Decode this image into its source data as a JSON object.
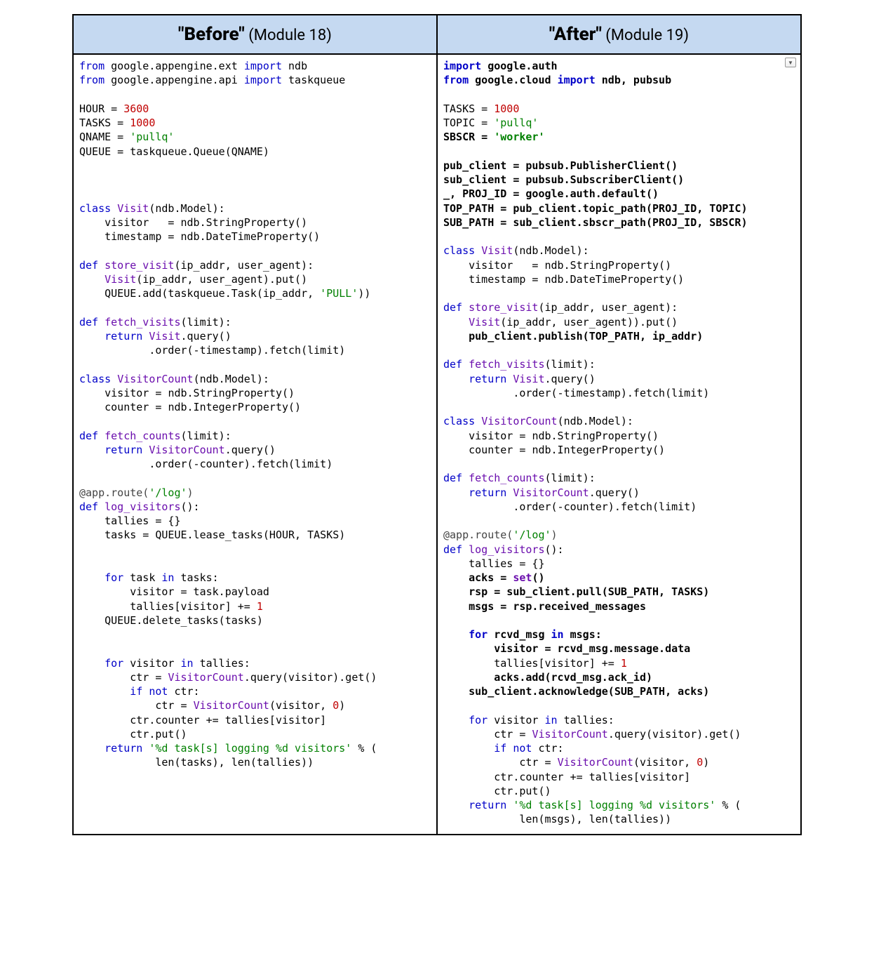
{
  "columns": {
    "before": {
      "title_quoted": "\"Before\"",
      "title_paren": " (Module 18)"
    },
    "after": {
      "title_quoted": "\"After\"",
      "title_paren": " (Module 19)"
    }
  },
  "code": {
    "before": {
      "imports": [
        "from google.appengine.ext import ndb",
        "from google.appengine.api import taskqueue"
      ],
      "constants": {
        "HOUR": 3600,
        "TASKS": 1000,
        "QNAME": "'pullq'",
        "QUEUE_expr": "taskqueue.Queue(QNAME)"
      },
      "class_visit": {
        "name": "Visit",
        "base": "ndb.Model",
        "visitor": "ndb.StringProperty()",
        "timestamp": "ndb.DateTimeProperty()"
      },
      "def_store_visit": {
        "sig": "store_visit(ip_addr, user_agent)",
        "l1": "Visit(ip_addr, user_agent).put()",
        "l2": "QUEUE.add(taskqueue.Task(ip_addr, 'PULL'))"
      },
      "def_fetch_visits": {
        "sig": "fetch_visits(limit)",
        "ret": "Visit.query()",
        "chain": ".order(-timestamp).fetch(limit)"
      },
      "class_visitorcount": {
        "name": "VisitorCount",
        "base": "ndb.Model",
        "visitor": "ndb.StringProperty()",
        "counter": "ndb.IntegerProperty()"
      },
      "def_fetch_counts": {
        "sig": "fetch_counts(limit)",
        "ret": "VisitorCount.query()",
        "chain": ".order(-counter).fetch(limit)"
      },
      "route": "@app.route('/log')",
      "def_log_visitors": {
        "sig": "log_visitors()",
        "tallies": "tallies = {}",
        "tasks": "tasks = QUEUE.lease_tasks(HOUR, TASKS)",
        "loop1_header": "for task in tasks:",
        "loop1_l1": "visitor = task.payload",
        "loop1_l2": "tallies[visitor] += 1",
        "delete": "QUEUE.delete_tasks(tasks)",
        "loop2_header": "for visitor in tallies:",
        "loop2_l1": "ctr = VisitorCount.query(visitor).get()",
        "loop2_l2": "if not ctr:",
        "loop2_l3": "ctr = VisitorCount(visitor, 0)",
        "loop2_l4": "ctr.counter += tallies[visitor]",
        "loop2_l5": "ctr.put()",
        "ret_fmt": "'%d task[s] logging %d visitors'",
        "ret_args": "len(tasks), len(tallies))"
      }
    },
    "after": {
      "imports": [
        "import google.auth",
        "from google.cloud import ndb, pubsub"
      ],
      "constants": {
        "TASKS": 1000,
        "TOPIC": "'pullq'",
        "SBSCR": "'worker'"
      },
      "setup": {
        "pub_client": "pubsub.PublisherClient()",
        "sub_client": "pubsub.SubscriberClient()",
        "proj_id": "_, PROJ_ID = google.auth.default()",
        "top_path": "TOP_PATH = pub_client.topic_path(PROJ_ID, TOPIC)",
        "sub_path": "SUB_PATH = sub_client.sbscr_path(PROJ_ID, SBSCR)"
      },
      "class_visit": {
        "name": "Visit",
        "base": "ndb.Model",
        "visitor": "ndb.StringProperty()",
        "timestamp": "ndb.DateTimeProperty()"
      },
      "def_store_visit": {
        "sig": "store_visit(ip_addr, user_agent)",
        "l1": "Visit(ip_addr, user_agent)).put()",
        "l2": "pub_client.publish(TOP_PATH, ip_addr)"
      },
      "def_fetch_visits": {
        "sig": "fetch_visits(limit)",
        "ret": "Visit.query()",
        "chain": ".order(-timestamp).fetch(limit)"
      },
      "class_visitorcount": {
        "name": "VisitorCount",
        "base": "ndb.Model",
        "visitor": "ndb.StringProperty()",
        "counter": "ndb.IntegerProperty()"
      },
      "def_fetch_counts": {
        "sig": "fetch_counts(limit)",
        "ret": "VisitorCount.query()",
        "chain": ".order(-counter).fetch(limit)"
      },
      "route": "@app.route('/log')",
      "def_log_visitors": {
        "sig": "log_visitors()",
        "tallies": "tallies = {}",
        "acks": "acks = set()",
        "rsp": "rsp = sub_client.pull(SUB_PATH, TASKS)",
        "msgs": "msgs = rsp.received_messages",
        "loop1_header": "for rcvd_msg in msgs:",
        "loop1_l1": "visitor = rcvd_msg.message.data",
        "loop1_l2": "tallies[visitor] += 1",
        "loop1_l3": "acks.add(rcvd_msg.ack_id)",
        "ack": "sub_client.acknowledge(SUB_PATH, acks)",
        "loop2_header": "for visitor in tallies:",
        "loop2_l1": "ctr = VisitorCount.query(visitor).get()",
        "loop2_l2": "if not ctr:",
        "loop2_l3": "ctr = VisitorCount(visitor, 0)",
        "loop2_l4": "ctr.counter += tallies[visitor]",
        "loop2_l5": "ctr.put()",
        "ret_fmt": "'%d task[s] logging %d visitors'",
        "ret_args": "len(msgs), len(tallies))"
      }
    }
  }
}
